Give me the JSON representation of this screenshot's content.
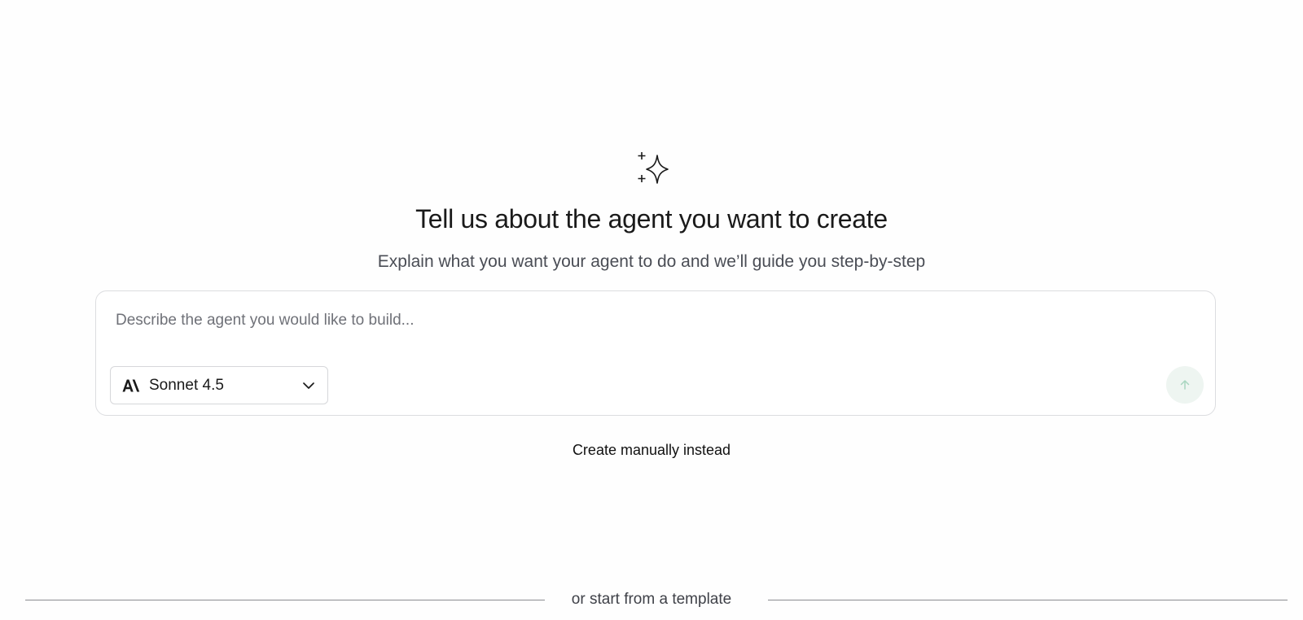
{
  "hero": {
    "title": "Tell us about the agent you want to create",
    "subtitle": "Explain what you want your agent to do and we’ll guide you step-by-step"
  },
  "composer": {
    "placeholder": "Describe the agent you would like to build...",
    "value": "",
    "model": {
      "selected": "Sonnet 4.5",
      "icon": "anthropic-logo-icon"
    },
    "send_icon": "arrow-up-icon"
  },
  "actions": {
    "create_manually": "Create manually instead"
  },
  "templates": {
    "divider_text": "or start from a template"
  },
  "colors": {
    "send_bg": "#eef5f1",
    "send_arrow": "#a9d6c0",
    "border": "#dcdde0"
  }
}
